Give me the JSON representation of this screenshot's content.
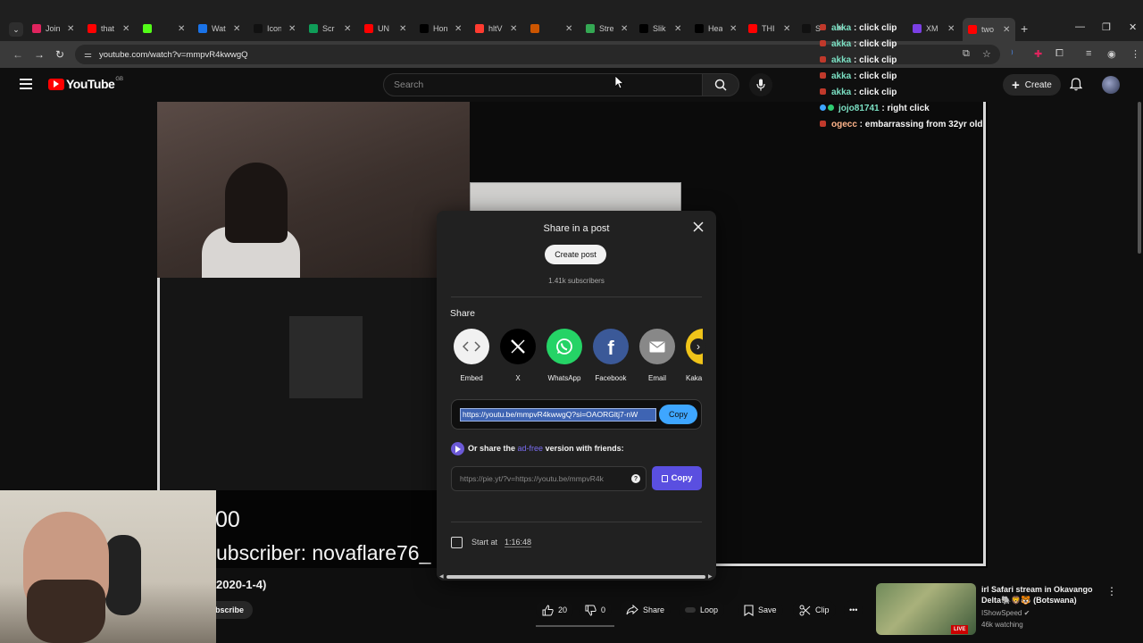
{
  "browser": {
    "tabs": [
      {
        "label": "Join",
        "color": "#e0245e"
      },
      {
        "label": "that",
        "color": "#ff0000"
      },
      {
        "label": "",
        "color": "#53fc18"
      },
      {
        "label": "Wat",
        "color": "#1a73e8"
      },
      {
        "label": "Icon",
        "color": "#111111"
      },
      {
        "label": "Scr",
        "color": "#0f9d58"
      },
      {
        "label": "UN",
        "color": "#ff0000"
      },
      {
        "label": "Hon",
        "color": "#000000"
      },
      {
        "label": "hltV",
        "color": "#ff3b30"
      },
      {
        "label": "",
        "color": "#cc5500"
      },
      {
        "label": "Stre",
        "color": "#34a853"
      },
      {
        "label": "Slik",
        "color": "#000000"
      },
      {
        "label": "Hea",
        "color": "#000000"
      },
      {
        "label": "THI",
        "color": "#ff0000"
      },
      {
        "label": "S",
        "color": "#111111"
      },
      {
        "label": "XM",
        "color": "#7b3fe4"
      },
      {
        "label": "two",
        "color": "#ff0000"
      }
    ],
    "url": "youtube.com/watch?v=mmpvR4kwwgQ"
  },
  "youtube": {
    "logo_text": "YouTube",
    "country": "GB",
    "search_placeholder": "Search",
    "create_label": "Create"
  },
  "stream_overlay": {
    "number_text": "00",
    "subscriber_text": "ubscriber: novaflare76_",
    "date_text": "2020-1-4)",
    "subscribe_label": "bscribe"
  },
  "chat": [
    {
      "user": "akka",
      "message": "click clip"
    },
    {
      "user": "akka",
      "message": "click clip"
    },
    {
      "user": "akka",
      "message": "click clip"
    },
    {
      "user": "akka",
      "message": "click clip"
    },
    {
      "user": "akka",
      "message": "click clip"
    },
    {
      "user": "jojo81741",
      "message": "right click"
    },
    {
      "user": "ogecc",
      "message": "embarrassing from 32yr old"
    }
  ],
  "share_dialog": {
    "title": "Share in a post",
    "create_post_label": "Create post",
    "subscribers": "1.41k subscribers",
    "share_heading": "Share",
    "options": [
      {
        "label": "Embed",
        "icon": "embed-icon",
        "color": "#f1f1f1"
      },
      {
        "label": "X",
        "icon": "x-logo-icon",
        "color": "#000000"
      },
      {
        "label": "WhatsApp",
        "icon": "whatsapp-icon",
        "color": "#25d366"
      },
      {
        "label": "Facebook",
        "icon": "facebook-icon",
        "color": "#3b5998"
      },
      {
        "label": "Email",
        "icon": "email-icon",
        "color": "#888888"
      },
      {
        "label": "Kaka",
        "icon": "kakaostory-icon",
        "color": "#f0c419"
      }
    ],
    "share_url": "https://youtu.be/mmpvR4kwwgQ?si=OAORGltj7-nW",
    "copy_label": "Copy",
    "adfree_prefix": "Or share the ",
    "adfree_link": "ad-free",
    "adfree_suffix": " version with friends:",
    "piped_url": "https://pie.yt/?v=https://youtu.be/mmpvR4k",
    "copy2_label": "Copy",
    "start_at_label": "Start at",
    "start_time": "1:16:48"
  },
  "actions": {
    "likes": "20",
    "dislikes": "0",
    "share_label": "Share",
    "loop_label": "Loop",
    "save_label": "Save",
    "clip_label": "Clip"
  },
  "recommendation": {
    "title": "irl Safari stream in Okavango Delta🐘🦁🐯 (Botswana)",
    "channel": "IShowSpeed",
    "watching": "46k watching",
    "badge": "LIVE"
  },
  "colors": {
    "accent": "#3ea6ff",
    "brand": "#ff0000",
    "piped_purple": "#5a4fe0"
  }
}
